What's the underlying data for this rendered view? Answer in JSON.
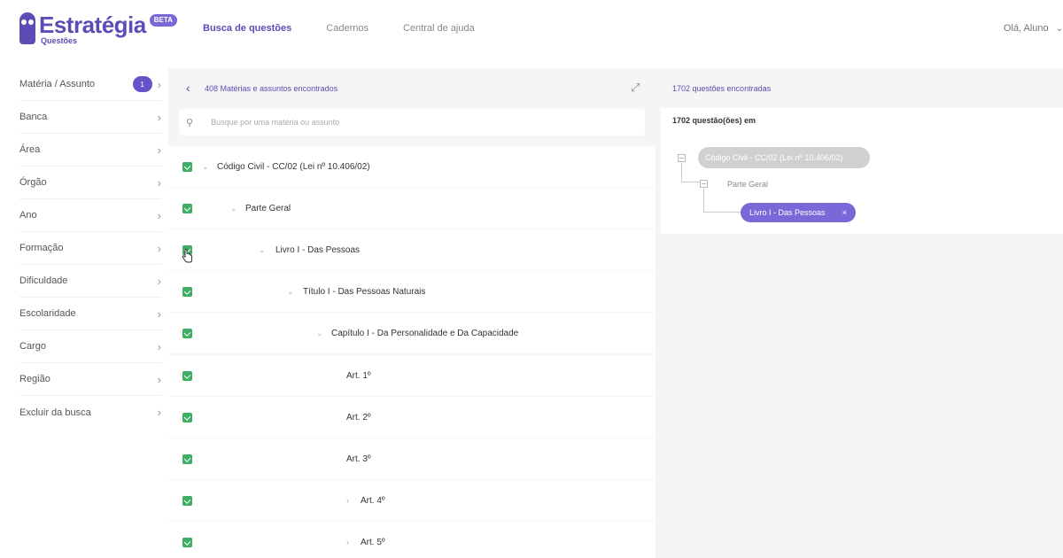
{
  "header": {
    "brand": "Estratégia",
    "brand_sub": "Questões",
    "beta": "BETA",
    "nav": [
      "Busca de questões",
      "Cadernos",
      "Central de ajuda"
    ],
    "greeting": "Olá, Aluno"
  },
  "sidebar": {
    "items": [
      {
        "label": "Matéria / Assunto",
        "badge": "1"
      },
      {
        "label": "Banca"
      },
      {
        "label": "Área"
      },
      {
        "label": "Órgão"
      },
      {
        "label": "Ano"
      },
      {
        "label": "Formação"
      },
      {
        "label": "Dificuldade"
      },
      {
        "label": "Escolaridade"
      },
      {
        "label": "Cargo"
      },
      {
        "label": "Região"
      },
      {
        "label": "Excluir da busca"
      }
    ]
  },
  "center": {
    "count_label": "408 Matérias e assuntos encontrados",
    "search_placeholder": "Busque por uma matéria ou assunto",
    "tree": [
      {
        "label": "Código Civil - CC/02 (Lei nº 10.406/02)",
        "caret": "⌄"
      },
      {
        "label": "Parte Geral",
        "caret": "⌄"
      },
      {
        "label": "Livro I - Das Pessoas",
        "caret": "⌄"
      },
      {
        "label": "Título I - Das Pessoas Naturais",
        "caret": "⌄"
      },
      {
        "label": "Capítulo I - Da Personalidade e Da Capacidade",
        "caret": "⌄"
      },
      {
        "label": "Art. 1º",
        "caret": ""
      },
      {
        "label": "Art. 2º",
        "caret": ""
      },
      {
        "label": "Art. 3º",
        "caret": ""
      },
      {
        "label": "Art. 4º",
        "caret": "›"
      },
      {
        "label": "Art. 5º",
        "caret": "›"
      }
    ]
  },
  "right": {
    "count_label": "1702 questões encontradas",
    "title": "1702 questão(ões) em",
    "crumb_root": "Código Civil - CC/02 (Lei nº 10.406/02)",
    "crumb_mid": "Parte Geral",
    "crumb_leaf": "Livro I - Das Pessoas",
    "remove": "×"
  },
  "colors": {
    "accent": "#5e4bb5",
    "check": "#3fae64",
    "pill": "#7b68d8"
  }
}
